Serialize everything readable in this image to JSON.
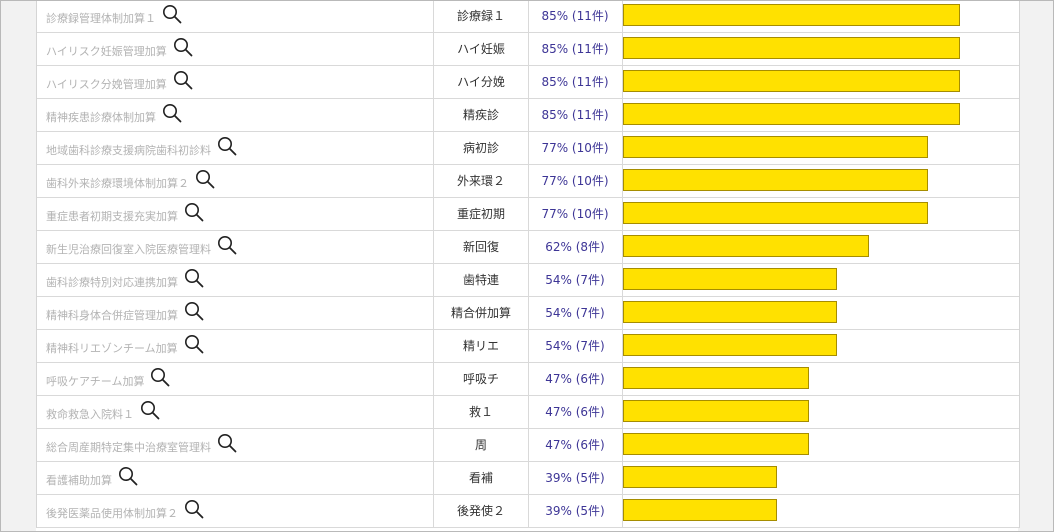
{
  "colors": {
    "bar_fill": "#ffe100",
    "bar_border": "#a68d00",
    "percent_text": "#3d3596",
    "name_text": "#b3b3b3"
  },
  "rows": [
    {
      "name": "診療録管理体制加算１",
      "abbr": "診療録１",
      "percent": "85% (11件)",
      "value": 85
    },
    {
      "name": "ハイリスク妊娠管理加算",
      "abbr": "ハイ妊娠",
      "percent": "85% (11件)",
      "value": 85
    },
    {
      "name": "ハイリスク分娩管理加算",
      "abbr": "ハイ分娩",
      "percent": "85% (11件)",
      "value": 85
    },
    {
      "name": "精神疾患診療体制加算",
      "abbr": "精疾診",
      "percent": "85% (11件)",
      "value": 85
    },
    {
      "name": "地域歯科診療支援病院歯科初診料",
      "abbr": "病初診",
      "percent": "77% (10件)",
      "value": 77
    },
    {
      "name": "歯科外来診療環境体制加算２",
      "abbr": "外来環２",
      "percent": "77% (10件)",
      "value": 77
    },
    {
      "name": "重症患者初期支援充実加算",
      "abbr": "重症初期",
      "percent": "77% (10件)",
      "value": 77
    },
    {
      "name": "新生児治療回復室入院医療管理料",
      "abbr": "新回復",
      "percent": "62% (8件)",
      "value": 62
    },
    {
      "name": "歯科診療特別対応連携加算",
      "abbr": "歯特連",
      "percent": "54% (7件)",
      "value": 54
    },
    {
      "name": "精神科身体合併症管理加算",
      "abbr": "精合併加算",
      "percent": "54% (7件)",
      "value": 54
    },
    {
      "name": "精神科リエゾンチーム加算",
      "abbr": "精リエ",
      "percent": "54% (7件)",
      "value": 54
    },
    {
      "name": "呼吸ケアチーム加算",
      "abbr": "呼吸チ",
      "percent": "47% (6件)",
      "value": 47
    },
    {
      "name": "救命救急入院料１",
      "abbr": "救１",
      "percent": "47% (6件)",
      "value": 47
    },
    {
      "name": "総合周産期特定集中治療室管理料",
      "abbr": "周",
      "percent": "47% (6件)",
      "value": 47
    },
    {
      "name": "看護補助加算",
      "abbr": "看補",
      "percent": "39% (5件)",
      "value": 39
    },
    {
      "name": "後発医薬品使用体制加算２",
      "abbr": "後発使２",
      "percent": "39% (5件)",
      "value": 39
    }
  ]
}
